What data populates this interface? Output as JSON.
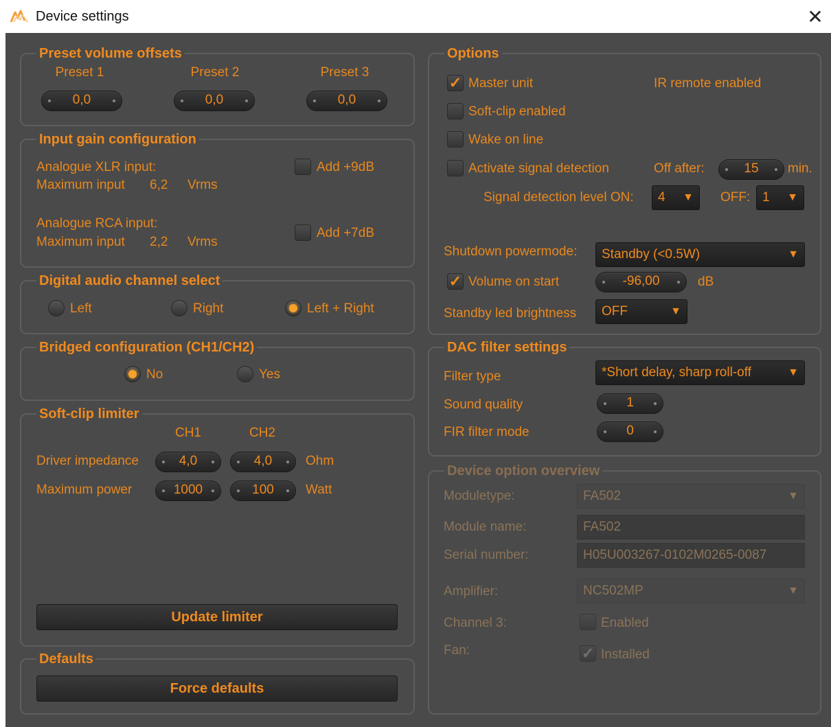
{
  "window": {
    "title": "Device settings",
    "app_icon": "wave-logo-icon",
    "close_icon": "close-icon",
    "close_glyph": "✕"
  },
  "preset_offsets": {
    "title": "Preset volume offsets",
    "presets": [
      {
        "label": "Preset 1",
        "value": "0,0"
      },
      {
        "label": "Preset 2",
        "value": "0,0"
      },
      {
        "label": "Preset 3",
        "value": "0,0"
      }
    ]
  },
  "input_gain": {
    "title": "Input gain configuration",
    "xlr": {
      "label": "Analogue XLR input:",
      "max_label": "Maximum input",
      "max_value": "6,2",
      "unit": "Vrms",
      "add_label": "Add +9dB",
      "add_checked": false
    },
    "rca": {
      "label": "Analogue RCA input:",
      "max_label": "Maximum input",
      "max_value": "2,2",
      "unit": "Vrms",
      "add_label": "Add +7dB",
      "add_checked": false
    }
  },
  "channel_select": {
    "title": "Digital audio channel select",
    "options": [
      {
        "label": "Left",
        "selected": false
      },
      {
        "label": "Right",
        "selected": false
      },
      {
        "label": "Left + Right",
        "selected": true
      }
    ]
  },
  "bridged": {
    "title": "Bridged configuration (CH1/CH2)",
    "options": [
      {
        "label": "No",
        "selected": true
      },
      {
        "label": "Yes",
        "selected": false
      }
    ]
  },
  "softclip": {
    "title": "Soft-clip limiter",
    "col1": "CH1",
    "col2": "CH2",
    "impedance": {
      "label": "Driver impedance",
      "ch1": "4,0",
      "ch2": "4,0",
      "unit": "Ohm"
    },
    "power": {
      "label": "Maximum power",
      "ch1": "1000",
      "ch2": "100",
      "unit": "Watt"
    },
    "update_button": "Update limiter"
  },
  "defaults": {
    "title": "Defaults",
    "force_button": "Force defaults"
  },
  "options": {
    "title": "Options",
    "master_unit": {
      "label": "Master unit",
      "checked": true
    },
    "ir_remote": "IR remote enabled",
    "softclip_enabled": {
      "label": "Soft-clip enabled",
      "checked": false
    },
    "wake_on_line": {
      "label": "Wake on line",
      "checked": false
    },
    "signal_detection": {
      "label": "Activate signal detection",
      "checked": false,
      "off_after_label": "Off after:",
      "off_after_value": "15",
      "off_after_unit": "min."
    },
    "detection_level": {
      "on_label": "Signal detection level ON:",
      "on_value": "4",
      "off_label": "OFF:",
      "off_value": "1"
    },
    "shutdown": {
      "label": "Shutdown powermode:",
      "value": "Standby (<0.5W)"
    },
    "volume_start": {
      "label": "Volume on start",
      "checked": true,
      "value": "-96,00",
      "unit": "dB"
    },
    "led_brightness": {
      "label": "Standby led brightness",
      "value": "OFF"
    }
  },
  "dac": {
    "title": "DAC filter settings",
    "filter_type": {
      "label": "Filter type",
      "value": "*Short delay, sharp roll-off"
    },
    "sound_quality": {
      "label": "Sound quality",
      "value": "1"
    },
    "fir_mode": {
      "label": "FIR filter mode",
      "value": "0"
    }
  },
  "overview": {
    "title": "Device option overview",
    "moduletype": {
      "label": "Moduletype:",
      "value": "FA502"
    },
    "module_name": {
      "label": "Module name:",
      "value": "FA502"
    },
    "serial": {
      "label": "Serial number:",
      "value": "H05U003267-0102M0265-0087"
    },
    "amplifier": {
      "label": "Amplifier:",
      "value": "NC502MP"
    },
    "channel3": {
      "label": "Channel 3:",
      "cb_label": "Enabled",
      "checked": false
    },
    "fan": {
      "label": "Fan:",
      "cb_label": "Installed",
      "checked": true
    }
  },
  "glyphs": {
    "check": "✓",
    "chevron": "▼"
  },
  "colors": {
    "accent": "#f08a1e",
    "dim_text": "#8a7358",
    "background": "#4a4a4a",
    "field": "#232323"
  }
}
